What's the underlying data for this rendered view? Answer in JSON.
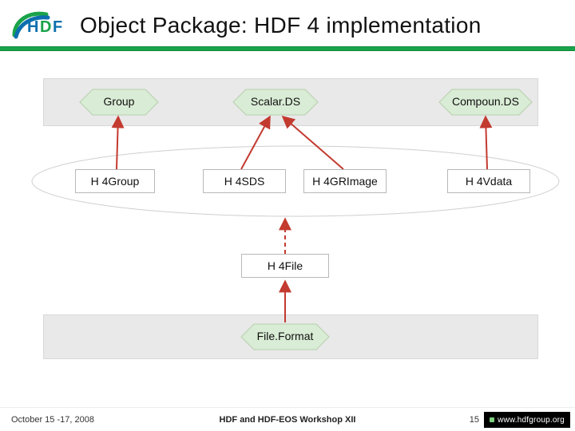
{
  "header": {
    "title": "Object Package: HDF 4 implementation"
  },
  "diagram": {
    "top_nodes": {
      "group": "Group",
      "scalar_ds": "Scalar.DS",
      "compound_ds": "Compoun.DS"
    },
    "impl_nodes": {
      "h4group": "H 4Group",
      "h4sds": "H 4SDS",
      "h4grimage": "H 4GRImage",
      "h4vdata": "H 4Vdata"
    },
    "h4file": "H 4File",
    "file_format": "File.Format"
  },
  "footer": {
    "date": "October 15 -17, 2008",
    "center": "HDF and HDF-EOS Workshop XII",
    "page": "15",
    "url": "www.hdfgroup.org"
  },
  "colors": {
    "accent_green": "#1aa34a",
    "hex_fill": "#d9ecd5",
    "arrow_red": "#c33a2f",
    "band": "#e9e9e9"
  }
}
